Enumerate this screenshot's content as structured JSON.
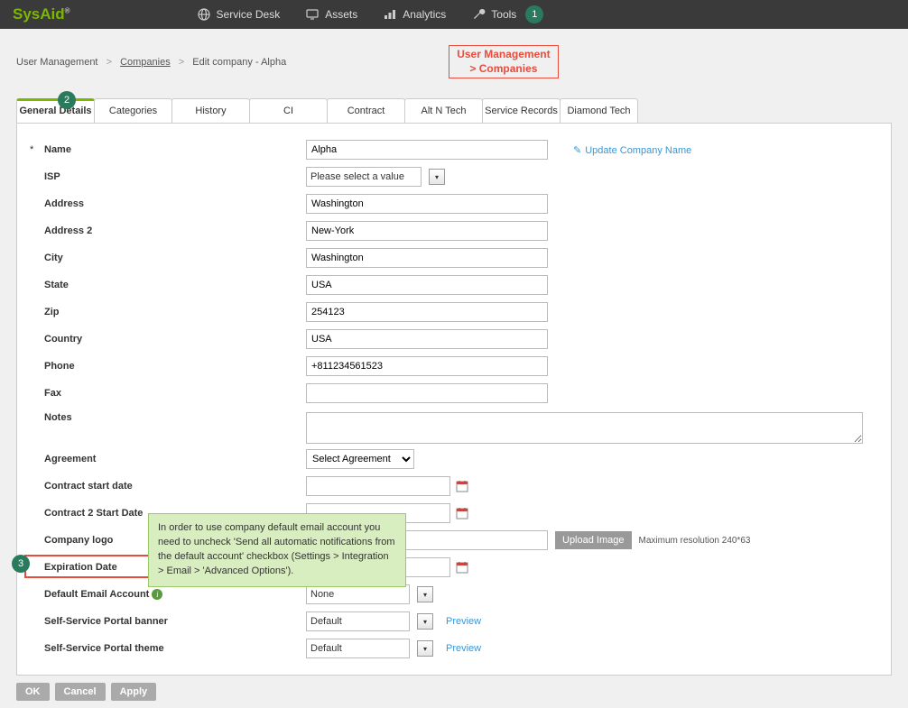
{
  "brand": "SysAid",
  "nav": [
    {
      "label": "Service Desk",
      "icon": "globe"
    },
    {
      "label": "Assets",
      "icon": "monitor"
    },
    {
      "label": "Analytics",
      "icon": "chart"
    },
    {
      "label": "Tools",
      "icon": "wrench"
    }
  ],
  "badges": {
    "tools": "1",
    "tabs": "2",
    "email": "3"
  },
  "breadcrumb": {
    "root": "User Management",
    "companies": "Companies",
    "current": "Edit company - Alpha"
  },
  "callout": {
    "line1": "User Management",
    "line2": "> Companies"
  },
  "tabs": [
    "General Details",
    "Categories",
    "History",
    "CI",
    "Contract",
    "Alt N Tech",
    "Service Records",
    "Diamond Tech"
  ],
  "form": {
    "labels": {
      "name": "Name",
      "isp": "ISP",
      "address": "Address",
      "address2": "Address 2",
      "city": "City",
      "state": "State",
      "zip": "Zip",
      "country": "Country",
      "phone": "Phone",
      "fax": "Fax",
      "notes": "Notes",
      "agreement": "Agreement",
      "contractStart": "Contract start date",
      "contract2Start": "Contract 2 Start Date",
      "logo": "Company logo",
      "expiration": "Expiration Date",
      "defaultEmail": "Default Email Account",
      "portalBanner": "Self-Service Portal banner",
      "portalTheme": "Self-Service Portal theme"
    },
    "values": {
      "name": "Alpha",
      "isp": "Please select a value",
      "address": "Washington",
      "address2": "New-York",
      "city": "Washington",
      "state": "USA",
      "zip": "254123",
      "country": "USA",
      "phone": "+811234561523",
      "fax": "",
      "notes": "",
      "agreement": "Select Agreement",
      "contractStart": "",
      "contract2Start": "",
      "logo": "",
      "expiration": "",
      "defaultEmail": "None",
      "portalBanner": "Default",
      "portalTheme": "Default"
    },
    "actions": {
      "updateName": "Update Company Name",
      "uploadImage": "Upload Image",
      "preview": "Preview"
    },
    "hints": {
      "resolution": "Maximum resolution 240*63"
    }
  },
  "tooltip": "In order to use company default email account you need to uncheck 'Send all automatic notifications from the default account' checkbox (Settings > Integration > Email > 'Advanced Options').",
  "buttons": {
    "ok": "OK",
    "cancel": "Cancel",
    "apply": "Apply"
  }
}
